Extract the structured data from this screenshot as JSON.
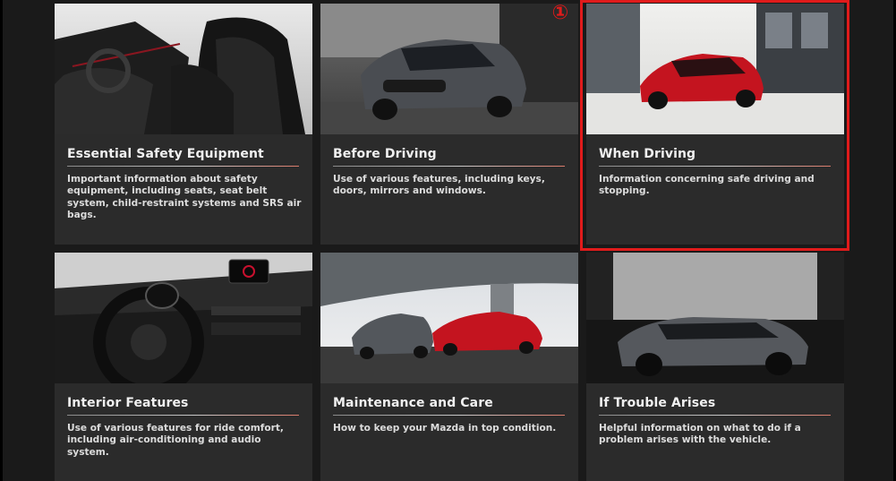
{
  "cards": [
    {
      "title": "Essential Safety Equipment",
      "description": "Important information about safety equipment, including seats, seat belt system, child-restraint systems and SRS air bags.",
      "image": "car-seats-interior-photo"
    },
    {
      "title": "Before Driving",
      "description": "Use of various features, including keys, doors, mirrors and windows.",
      "image": "grey-car-front-photo"
    },
    {
      "title": "When Driving",
      "description": "Information concerning safe driving and stopping.",
      "image": "red-car-street-photo"
    },
    {
      "title": "Interior Features",
      "description": "Use of various features for ride comfort, including air-conditioning and audio system.",
      "image": "dashboard-steering-wheel-photo"
    },
    {
      "title": "Maintenance and Care",
      "description": "How to keep your Mazda in top condition.",
      "image": "grey-and-red-cars-photo"
    },
    {
      "title": "If Trouble Arises",
      "description": "Helpful information on what to do if a problem arises with the vehicle.",
      "image": "grey-hatchback-side-photo"
    }
  ],
  "annotation": {
    "marker": "①",
    "highlight_color": "#e01b1b"
  },
  "colors": {
    "background": "#1a1a1a",
    "card": "#2b2b2b",
    "accent_red": "#c8102e"
  }
}
